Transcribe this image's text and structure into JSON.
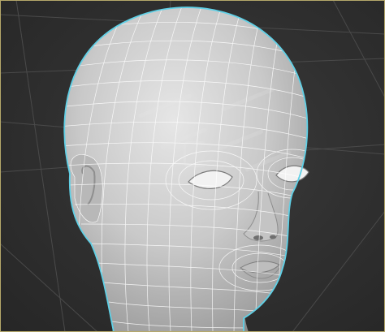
{
  "viewport": {
    "name": "3D viewport",
    "background_color": "#2f2f2f",
    "grid_color": "#4a4a4a",
    "border_color": "#b5a86a",
    "selection_outline_color": "#5fd0e6"
  },
  "model": {
    "kind": "head mesh wireframe",
    "surface_color": "#cfcfcf",
    "wire_color": "#ffffff",
    "shaded": true,
    "wireframe_overlay": true,
    "selected": true
  },
  "watermark": {
    "logo_icon": "cg-logo-icon",
    "opacity": 0.28
  }
}
